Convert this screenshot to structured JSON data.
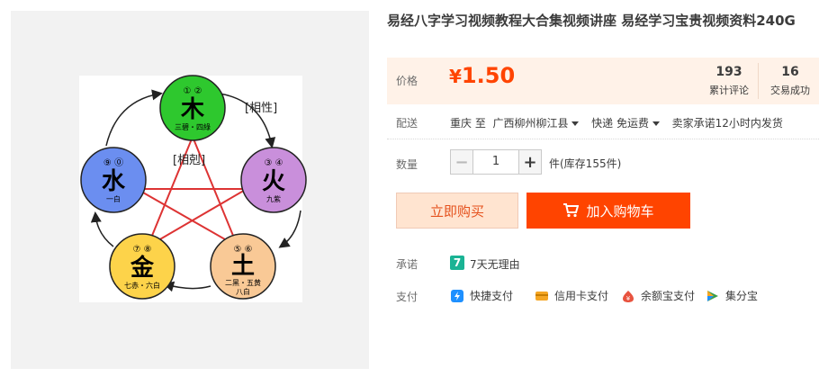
{
  "product": {
    "title": "易经八字学习视频教程大合集视频讲座 易经学习宝贵视频资料240G"
  },
  "image": {
    "elements": [
      {
        "char": "木",
        "nums": "① ②",
        "caption": "三碧・四綠",
        "color": "#2ec82e"
      },
      {
        "char": "火",
        "nums": "③ ④",
        "caption": "九紫",
        "color": "#c98fdb"
      },
      {
        "char": "土",
        "nums": "⑤ ⑥",
        "caption": "二黑・五黄",
        "caption2": "八白",
        "color": "#f9c996"
      },
      {
        "char": "金",
        "nums": "⑦ ⑧",
        "caption": "七赤・六白",
        "color": "#fdd34a"
      },
      {
        "char": "水",
        "nums": "⑨ ⓪",
        "caption": "一白",
        "color": "#6b8ef0"
      }
    ],
    "label_generating": "[相性]",
    "label_overcoming": "[相剋]"
  },
  "price": {
    "label": "价格",
    "currency": "¥",
    "amount": "1.50",
    "reviews_count": "193",
    "reviews_label": "累计评论",
    "sold_count": "16",
    "sold_label": "交易成功"
  },
  "shipping": {
    "label": "配送",
    "from": "重庆 至",
    "to": "广西柳州柳江县",
    "method": "快递 免运费",
    "promise": "卖家承诺12小时内发货"
  },
  "quantity": {
    "label": "数量",
    "value": "1",
    "minus": "−",
    "plus": "+",
    "stock_text": "件(库存155件)"
  },
  "actions": {
    "buy_now": "立即购买",
    "add_to_cart": "加入购物车"
  },
  "promise": {
    "label": "承诺",
    "badge": "7",
    "text": "7天无理由"
  },
  "payment": {
    "label": "支付",
    "methods": [
      {
        "label": "快捷支付",
        "icon": "quick-pay-icon",
        "color": "#1e90ff"
      },
      {
        "label": "信用卡支付",
        "icon": "credit-card-icon",
        "color": "#f5a623"
      },
      {
        "label": "余额宝支付",
        "icon": "yuebao-icon",
        "color": "#e8533f"
      },
      {
        "label": "集分宝",
        "icon": "jifenbao-icon",
        "color": "#3b9e4a"
      }
    ]
  },
  "colors": {
    "accent": "#ff4400",
    "price_bg": "#fff2e8",
    "buy_bg": "#ffe4d0"
  }
}
